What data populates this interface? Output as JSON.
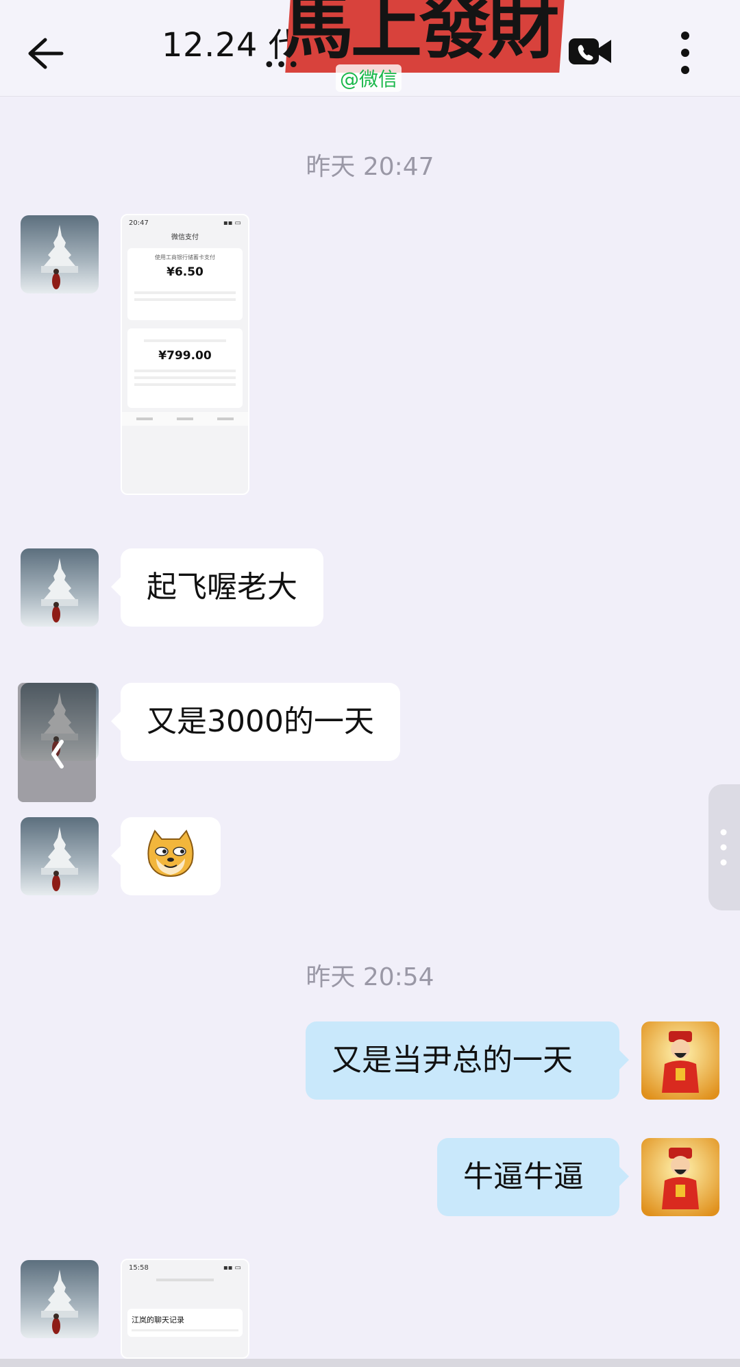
{
  "header": {
    "title": "12.24 代",
    "overlay_sticker_text": "馬上發財",
    "overlay_watermark": "@微信"
  },
  "messages": {
    "time1": "昨天  20:47",
    "screenshot1": {
      "status_time": "20:47",
      "page_title": "微信支付",
      "subtitle": "使用工商银行储蓄卡支付",
      "amount1": "¥6.50",
      "amount2": "¥799.00"
    },
    "msg_qifei": "起飞喔老大",
    "msg_3000": "又是3000的一天",
    "time2": "昨天  20:54",
    "msg_yinzong": "又是当尹总的一天",
    "msg_niubi": "牛逼牛逼",
    "screenshot2": {
      "status_time": "15:58",
      "title_line": "江岚的聊天记录"
    }
  },
  "colors": {
    "background": "#f1eff9",
    "incoming_bubble": "#ffffff",
    "outgoing_bubble": "#c9e8fb",
    "timestamp": "#9a98a6",
    "watermark_green": "#19b84a"
  }
}
